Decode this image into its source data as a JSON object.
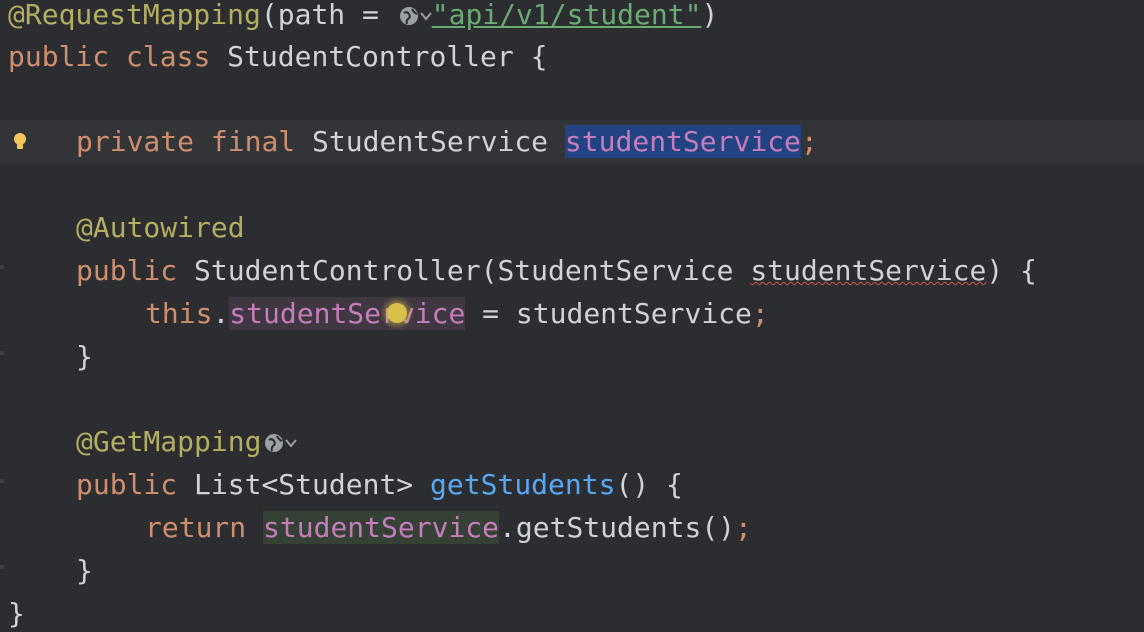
{
  "lines": {
    "l1": {
      "ann": "@RequestMapping",
      "open": "(path = ",
      "str": "\"api/v1/student\"",
      "close": ")"
    },
    "l2": {
      "kw1": "public",
      "kw2": "class",
      "name": "StudentController {"
    },
    "l4": {
      "kw1": "private",
      "kw2": "final",
      "type": "StudentService",
      "field": "studentService",
      "semi": ";"
    },
    "l6": {
      "ann": "@Autowired"
    },
    "l7": {
      "kw1": "public",
      "name": "StudentController(StudentService ",
      "param": "studentService",
      "close": ") {"
    },
    "l8": {
      "kw": "this",
      "dot": ".",
      "field": "studentService",
      "rest": " = studentService",
      "semi": ";"
    },
    "l9": {
      "text": "}"
    },
    "l11": {
      "ann": "@GetMapping"
    },
    "l12": {
      "kw1": "public",
      "type": "List<Student> ",
      "method": "getStudents",
      "rest": "() {"
    },
    "l13": {
      "kw": "return",
      "field": "studentService",
      "rest": ".getStudents()",
      "semi": ";"
    },
    "l14": {
      "text": "}"
    },
    "l15": {
      "text": "}"
    }
  },
  "icons": {
    "web": "globe-icon",
    "chevron": "chevron-down-icon",
    "bulb": "lightbulb-icon"
  },
  "colors": {
    "background": "#2b2d30",
    "keyword": "#cf8e6d",
    "annotation": "#b3ae60",
    "field": "#c77dbb",
    "string": "#6aab73",
    "selection": "#214283"
  }
}
